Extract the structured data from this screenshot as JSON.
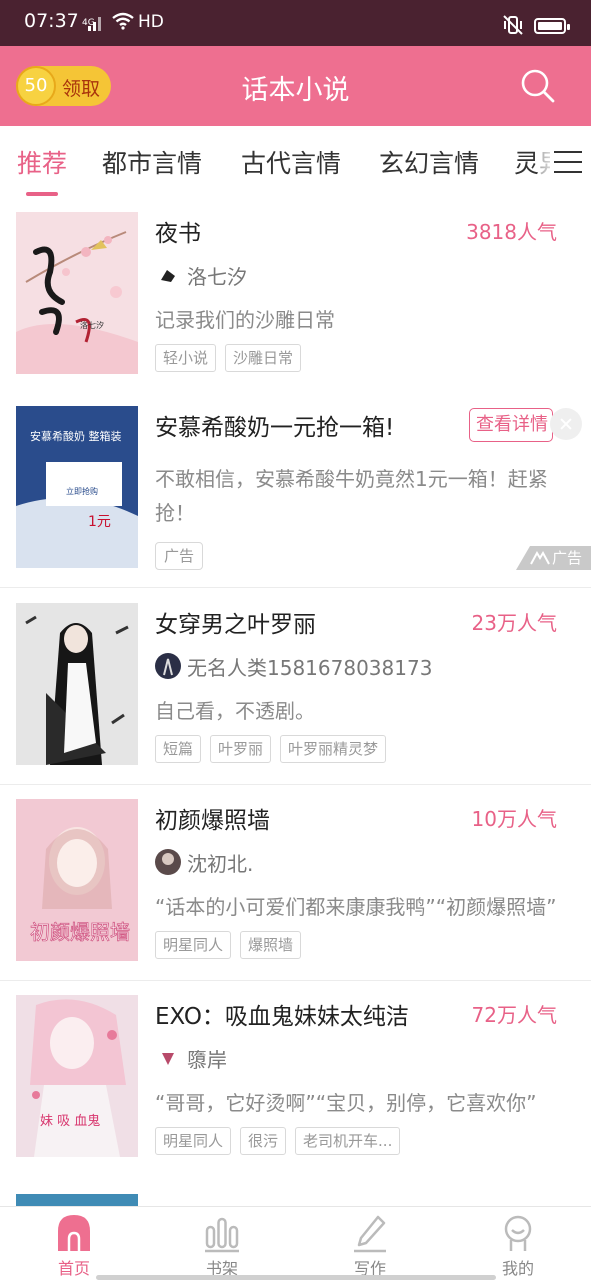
{
  "status_bar": {
    "time": "07:37",
    "network": "4G",
    "hd": "HD"
  },
  "header": {
    "coins": "50",
    "claim_label": "领取",
    "title": "话本小说"
  },
  "tabs": [
    "推荐",
    "都市言情",
    "古代言情",
    "玄幻言情",
    "灵异"
  ],
  "active_tab": "推荐",
  "items": [
    {
      "title": "夜书",
      "popularity": "3818人气",
      "author": "洛七汐",
      "desc": "记录我们的沙雕日常",
      "tags": [
        "轻小说",
        "沙雕日常"
      ],
      "cover_text": "夜书",
      "cover_author": "洛七汐"
    },
    {
      "title": "女穿男之叶罗丽",
      "popularity": "23万人气",
      "author": "无名人类1581678038173",
      "desc": "自己看，不透剧。",
      "tags": [
        "短篇",
        "叶罗丽",
        "叶罗丽精灵梦"
      ]
    },
    {
      "title": "初颜爆照墙",
      "popularity": "10万人气",
      "author": "沈初北.",
      "desc": "“话本的小可爱们都来康康我鸭”“初颜爆照墙”",
      "tags": [
        "明星同人",
        "爆照墙"
      ],
      "cover_text": "初颜爆照墙"
    },
    {
      "title": "EXO：吸血鬼妹妹太纯洁",
      "popularity": "72万人气",
      "author": "隳岸",
      "desc": "“哥哥，它好烫啊”“宝贝，别停，它喜欢你”",
      "tags": [
        "明星同人",
        "很污",
        "老司机开车..."
      ],
      "cover_text": "妹 吸 血鬼"
    }
  ],
  "ad": {
    "title": "安慕希酸奶一元抢一箱!",
    "detail_button": "查看详情",
    "desc": "不敢相信，安慕希酸牛奶竟然1元一箱！赶紧抢！",
    "badge": "广告",
    "mark": "广告",
    "image_title": "安慕希酸奶 整箱装",
    "image_card": "立即抢购",
    "image_price": "1元"
  },
  "bottom_nav": [
    {
      "label": "首页",
      "icon": "home-icon",
      "active": true
    },
    {
      "label": "书架",
      "icon": "bookshelf-icon",
      "active": false
    },
    {
      "label": "写作",
      "icon": "pen-icon",
      "active": false
    },
    {
      "label": "我的",
      "icon": "profile-icon",
      "active": false
    }
  ],
  "colors": {
    "brand_pink": "#ee6f90",
    "accent_pink": "#e86187",
    "status_bar": "#4a2230",
    "coin_gold": "#f5c536"
  }
}
